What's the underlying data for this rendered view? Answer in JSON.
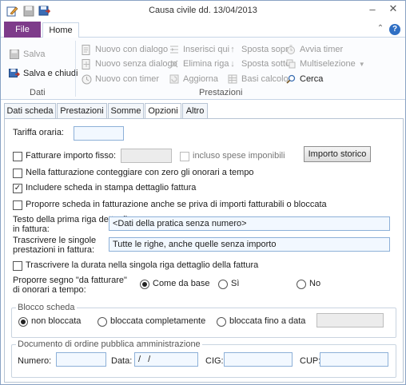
{
  "window": {
    "title": "Causa civile dd. 13/04/2013"
  },
  "quick_access": [
    "edit-icon",
    "save-icon",
    "save-close-icon"
  ],
  "window_controls": {
    "minimize": "–",
    "close": "✕"
  },
  "ribbon": {
    "tabs": {
      "file": "File",
      "home": "Home"
    },
    "help_icon": "?",
    "collapse_icon": "⌃",
    "groups": {
      "dati": {
        "label": "Dati",
        "salva": "Salva",
        "salva_chiudi": "Salva e chiudi"
      },
      "prestazioni": {
        "label": "Prestazioni",
        "nuovo_dialogo": "Nuovo con dialogo",
        "nuovo_senza_dialogo": "Nuovo senza dialogo",
        "nuovo_timer": "Nuovo con timer",
        "inserisci_qui": "Inserisci qui",
        "elimina_riga": "Elimina riga",
        "aggiorna": "Aggiorna",
        "sposta_sopra": "Sposta sopra",
        "sposta_sotto": "Sposta sotto",
        "basi_calcolo": "Basi calcolo",
        "avvia_timer": "Avvia timer",
        "multiselezione": "Multiselezione",
        "cerca": "Cerca"
      }
    }
  },
  "tabs": [
    "Dati scheda",
    "Prestazioni",
    "Somme",
    "Opzioni",
    "Altro"
  ],
  "options": {
    "tariffa_oraria": {
      "label": "Tariffa oraria:",
      "value": ""
    },
    "fatturare_importo_fisso": {
      "label": "Fatturare importo fisso:",
      "checked": false,
      "value": ""
    },
    "incluso_spese": {
      "label": "incluso spese imponibili",
      "checked": false
    },
    "importo_storico": "Importo storico",
    "conteggiare_zero": {
      "label": "Nella fatturazione conteggiare con zero gli onorari a tempo",
      "checked": false
    },
    "includere_scheda": {
      "label": "Includere scheda in stampa dettaglio fattura",
      "checked": true
    },
    "proporre_scheda": {
      "label": "Proporre scheda in fatturazione anche se priva di importi fatturabili o bloccata",
      "checked": false
    },
    "testo_prima_riga": {
      "label_line1": "Testo della prima riga dettaglio",
      "label_line2": "in fattura:",
      "value": "<Dati della pratica senza numero>"
    },
    "trascrivere_righe": {
      "label_line1": "Trascrivere le singole",
      "label_line2": "prestazioni in fattura:",
      "value": "Tutte le righe, anche quelle senza importo"
    },
    "trascrivere_durata": {
      "label": "Trascrivere la durata nella singola riga dettaglio della fattura",
      "checked": false
    },
    "proporre_segno": {
      "label_line1": "Proporre segno \"da fatturare\"",
      "label_line2": "di onorari a tempo:",
      "options": [
        "Come da base",
        "Sì",
        "No"
      ],
      "selected": "Come da base"
    },
    "blocco_scheda": {
      "legend": "Blocco scheda",
      "options": [
        "non bloccata",
        "bloccata completamente",
        "bloccata fino a data"
      ],
      "selected": "non bloccata",
      "date": ""
    },
    "documento_pa": {
      "legend": "Documento di ordine pubblica amministrazione",
      "numero_label": "Numero:",
      "numero": "",
      "data_label": "Data:",
      "data": " /  /",
      "cig_label": "CIG:",
      "cig": "",
      "cup_label": "CUP:",
      "cup": ""
    }
  }
}
